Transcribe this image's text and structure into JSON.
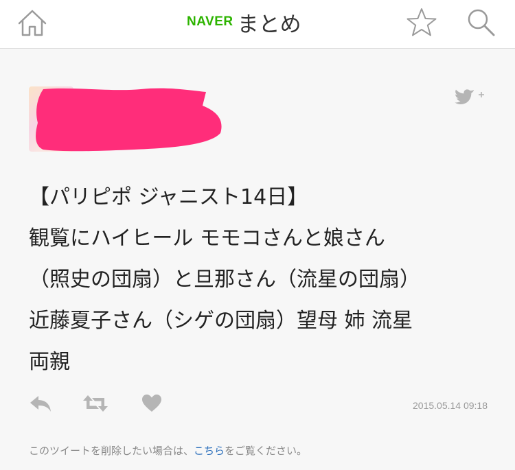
{
  "header": {
    "brand": "NAVER",
    "title": "まとめ",
    "icons": {
      "home": "home-icon",
      "favorite": "star-icon",
      "search": "search-icon"
    }
  },
  "tweet": {
    "author_redacted": true,
    "share_icon": "twitter-bird-plus-icon",
    "lines": [
      "【パリピポ ジャニスト14日】",
      "観覧にハイヒール モモコさんと娘さん",
      "（照史の団扇）と旦那さん（流星の団扇）",
      "近藤夏子さん（シゲの団扇）望母 姉 流星",
      "両親"
    ],
    "actions": {
      "reply": "reply-icon",
      "retweet": "retweet-icon",
      "like": "heart-icon"
    },
    "timestamp": "2015.05.14 09:18"
  },
  "notice": {
    "prefix": "このツイートを削除したい場合は、",
    "link": "こちら",
    "suffix": "をご覧ください。"
  },
  "colors": {
    "brand_green": "#2db400",
    "redaction": "#ff2d7a",
    "link": "#2a6ebb",
    "icon_gray": "#b5b5b5"
  }
}
